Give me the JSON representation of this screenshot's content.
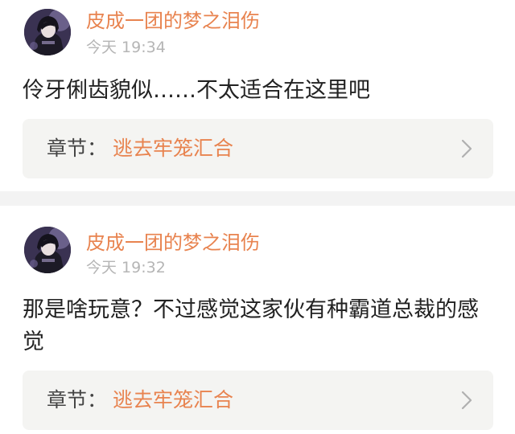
{
  "comments": [
    {
      "username": "皮成一团的梦之泪伤",
      "timestamp": "今天 19:34",
      "text": "伶牙俐齿貌似……不太适合在这里吧",
      "chapter": {
        "prefix": "章节：",
        "title": "逃去牢笼汇合"
      }
    },
    {
      "username": "皮成一团的梦之泪伤",
      "timestamp": "今天 19:32",
      "text": "那是啥玩意？不过感觉这家伙有种霸道总裁的感觉",
      "chapter": {
        "prefix": "章节：",
        "title": "逃去牢笼汇合"
      }
    }
  ],
  "colors": {
    "accent": "#e8834f",
    "timestamp": "#b5b5b5",
    "text": "#222222",
    "card_bg": "#f4f4f2",
    "separator": "#f3f3f3"
  },
  "icons": {
    "avatar": "avatar-image",
    "chevron": "chevron-right-icon"
  }
}
